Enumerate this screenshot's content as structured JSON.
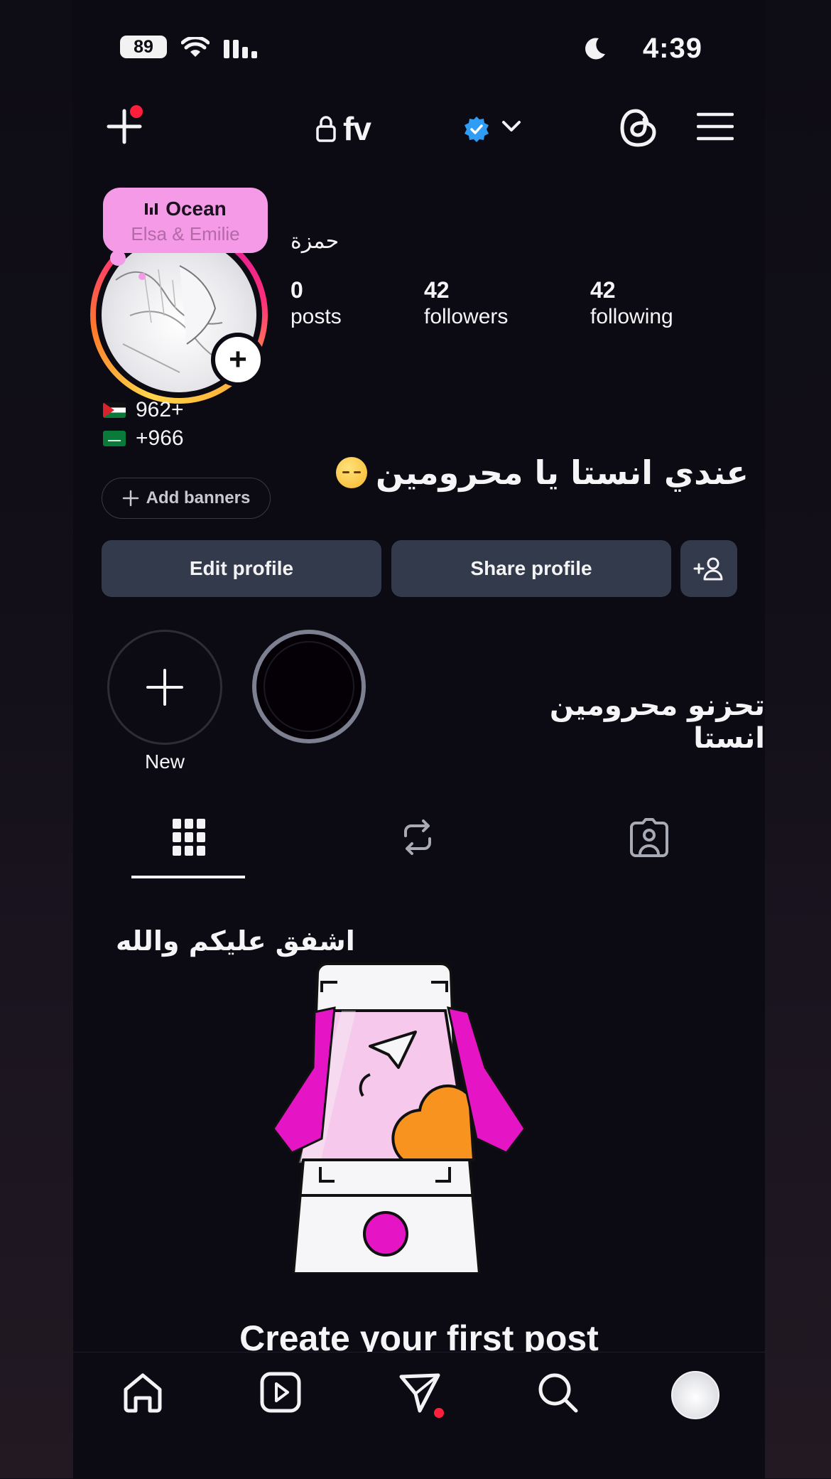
{
  "status_bar": {
    "battery": "89",
    "time": "4:39"
  },
  "header": {
    "username": "fv"
  },
  "note": {
    "title": "Ocean",
    "subtitle": "Elsa & Emilie"
  },
  "profile": {
    "display_name": "حمزة",
    "stats": [
      {
        "value": "0",
        "label": "posts"
      },
      {
        "value": "42",
        "label": "followers"
      },
      {
        "value": "42",
        "label": "following"
      }
    ],
    "bio_lines": [
      {
        "flag": "jordan-flag",
        "text": "962+"
      },
      {
        "flag": "saudi-flag",
        "text": "+966"
      }
    ],
    "add_banners": "Add banners",
    "bio_arabic": "عندي انستا يا محرومين"
  },
  "buttons": {
    "edit": "Edit profile",
    "share": "Share profile"
  },
  "highlights": {
    "new_label": "New",
    "caption": "تحزنو محرومين انستا"
  },
  "tabs": [
    "posts-grid",
    "reposts",
    "tagged"
  ],
  "overlay_text": "اشفق عليكم والله",
  "cta": "Create your first post",
  "bottom_nav": [
    "home",
    "reels",
    "messages",
    "search",
    "profile"
  ],
  "colors": {
    "accent_pink": "#e514c4",
    "note_bg": "#f49ae6",
    "button_bg": "#333a4c",
    "notification": "#ff1f3d",
    "verified_blue": "#2f9cf6"
  }
}
